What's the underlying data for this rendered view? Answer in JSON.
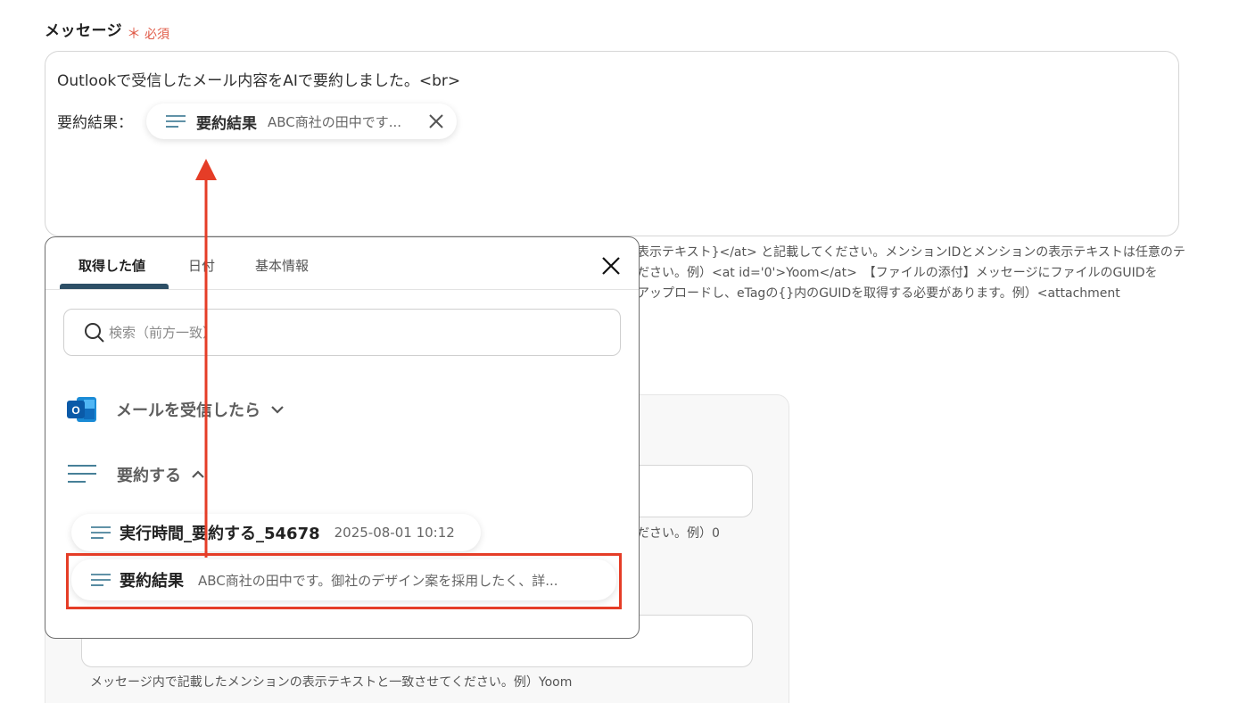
{
  "field": {
    "label": "メッセージ",
    "required": "必須"
  },
  "message": {
    "line1": "Outlookで受信したメール内容をAIで要約しました。<br>",
    "line2_label": "要約結果：",
    "chip": {
      "title": "要約結果",
      "value": "ABC商社の田中です..."
    }
  },
  "help": {
    "line1": "表示テキスト}</at> と記載してください。メンションIDとメンションの表示テキストは任意のテ",
    "line2": "ださい。例）<at id='0'>Yoom</at>　【ファイルの添付】メッセージにファイルのGUIDを",
    "line3": "アップロードし、eTagの{}内のGUIDを取得する必要があります。例）<attachment",
    "hint1": "ださい。例）0",
    "hint2": "メッセージ内で記載したメンションの表示テキストと一致させてください。例）Yoom"
  },
  "popup": {
    "tabs": [
      "取得した値",
      "日付",
      "基本情報"
    ],
    "search": {
      "placeholder": "検索（前方一致）",
      "value": ""
    },
    "groups": [
      {
        "label": "メールを受信したら",
        "icon": "outlook-icon",
        "expanded": false
      },
      {
        "label": "要約する",
        "icon": "lines-icon",
        "expanded": true
      }
    ],
    "items": [
      {
        "title": "実行時間_要約する_54678",
        "value": "2025-08-01 10:12"
      },
      {
        "title": "要約結果",
        "value": "ABC商社の田中です。御社のデザイン案を採用したく、詳..."
      }
    ]
  },
  "colors": {
    "accent": "#2d4f66",
    "highlight": "#e53d27",
    "required": "#e05a47"
  }
}
